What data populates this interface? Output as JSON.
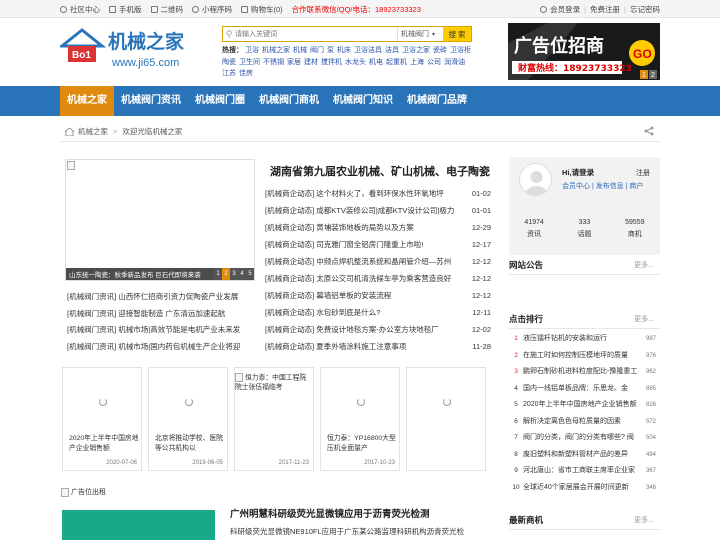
{
  "topbar": {
    "items": [
      {
        "icon": "home-icon",
        "label": "社区中心"
      },
      {
        "icon": "phone-icon",
        "label": "手机版"
      },
      {
        "icon": "qrcode-icon",
        "label": "二维码"
      },
      {
        "icon": "miniprogram-icon",
        "label": "小程序码"
      },
      {
        "icon": "cart-icon",
        "label": "购物车(0)"
      }
    ],
    "contact": "合作联系微信/QQ/电话：18923733323",
    "right": {
      "login": "会员登录",
      "register": "免费注册",
      "forgot": "忘记密码"
    }
  },
  "header": {
    "logo_text": "机械之家",
    "logo_badge": "Bo1",
    "logo_url": "www.ji65.com",
    "search_placeholder": "请输入关键词",
    "search_category": "机械阀门",
    "search_button": "搜 索",
    "hot_label": "热搜：",
    "hot_words": [
      "卫浴",
      "机械之家",
      "机械",
      "阀门",
      "泵",
      "机床",
      "卫浴洁具",
      "洁具",
      "卫浴之家",
      "瓷砖",
      "卫浴柜",
      "陶瓷",
      "卫生间",
      "不锈钢",
      "家居",
      "建材",
      "搅拌机",
      "水龙头",
      "机电",
      "起重机",
      "上海",
      "公司",
      "润滑油",
      "江苏",
      "佳房"
    ],
    "ad_title": "广告位招商",
    "ad_go": "GO",
    "ad_phone": "财富热线：18923733323",
    "ad_pager": [
      "1",
      "2"
    ]
  },
  "nav": [
    {
      "label": "机械之家",
      "active": true
    },
    {
      "label": "机械阀门资讯",
      "active": false
    },
    {
      "label": "机械阀门圈",
      "active": false
    },
    {
      "label": "机械阀门商机",
      "active": false
    },
    {
      "label": "机械阀门知识",
      "active": false
    },
    {
      "label": "机械阀门品牌",
      "active": false
    }
  ],
  "breadcrumb": {
    "home": "机械之家",
    "sep": ">",
    "current": "欢迎光临机械之家"
  },
  "slider": {
    "caption": "山东统一陶瓷：秋季新品发布 巨石代即将来袭",
    "dots": [
      "1",
      "2",
      "3",
      "4",
      "5"
    ]
  },
  "headline": "湖南省第九届农业机械、矿山机械、电子陶瓷",
  "news": [
    {
      "title": "[机械商企动态] 这个材料火了，看到环保水性环氧地坪",
      "date": "01-02"
    },
    {
      "title": "[机械商企动态] 成都KTV装修公司|成都KTV设计公司|极力",
      "date": "01-01"
    },
    {
      "title": "[机械商企动态] 黄埔装饰地板的局势以及方案",
      "date": "12-29"
    },
    {
      "title": "[机械商企动态] 司克雅门窗全铝房门隆重上市啦!",
      "date": "12-17"
    },
    {
      "title": "[机械商企动态] 中频点焊机整流系统和晶闸管介绍—苏州",
      "date": "12-12"
    },
    {
      "title": "[机械商企动态] 太原公交司机清洗候车亭为乘客营造良好",
      "date": "12-12"
    },
    {
      "title": "[机械商企动态] 幕墙铝单板的安装流程",
      "date": "12-12"
    },
    {
      "title": "[机械商企动态] 水包砂到底是什么?",
      "date": "12-11"
    },
    {
      "title": "[机械商企动态] 免费设计地毯方案-办公室方块地毯厂",
      "date": "12-02"
    },
    {
      "title": "[机械商企动态] 夏季外墙涂料施工注意事项",
      "date": "11-28"
    }
  ],
  "left_news": [
    "[机械阀门资讯] 山西怀仁招商引资力促陶瓷产业发展",
    "[机械阀门资讯] 迎接智能制造 广东清远加速起航",
    "[机械阀门资讯] 机械市场|高效节能是电机产业未来发",
    "[机械阀门资讯] 机械市场|国内药包机械生产企业将迎"
  ],
  "cards": [
    {
      "type": "spinner",
      "title": "2020年上半年中国房地产企业销售额",
      "date": "2020-07-06"
    },
    {
      "type": "spinner",
      "title": "北京将推动学校、医院等公共机构以",
      "date": "2019-06-05"
    },
    {
      "type": "broken",
      "alt": "恒力泰：中国工程院院士张伍福临考",
      "title": "",
      "date": "2017-11-23"
    },
    {
      "type": "spinner",
      "title": "恒力泰：YP16800大型压机全面量产",
      "date": "2017-10-23"
    },
    {
      "type": "spinner",
      "title": "",
      "date": ""
    }
  ],
  "ad_label": "广告位出租",
  "article": {
    "title": "广州明慧科研级荧光显微镜应用于沥青荧光检测",
    "summary": "科研级荧光显微镜NE910FL应用于广东某公路监理科研机构沥青荧光检"
  },
  "login": {
    "greeting": "Hi,请登录",
    "register": "注册",
    "links": "会员中心 | 发布信息 | 商户",
    "stats": [
      {
        "value": "41974",
        "label": "资讯"
      },
      {
        "value": "333",
        "label": "话题"
      },
      {
        "value": "59559",
        "label": "商机"
      }
    ]
  },
  "notice": {
    "title": "网站公告",
    "more": "更多..."
  },
  "ranking": {
    "title": "点击排行",
    "more": "更多...",
    "items": [
      {
        "n": "1",
        "title": "液压镭杆钻机的安装和运行",
        "count": "987"
      },
      {
        "n": "2",
        "title": "在施工时如何控制压模地坪的质量",
        "count": "976"
      },
      {
        "n": "3",
        "title": "鹏卵石制砂机进料粒度配比-豫隆重工",
        "count": "962"
      },
      {
        "n": "4",
        "title": "国内一线铝单板品牌：乐思龙、金",
        "count": "885"
      },
      {
        "n": "5",
        "title": "2020年上半年中国房地产企业销售额",
        "count": "826"
      },
      {
        "n": "6",
        "title": "解析决定离色色母粒质量的因素",
        "count": "572"
      },
      {
        "n": "7",
        "title": "阀门的分类，阀门的分类有哪些? 阀",
        "count": "504"
      },
      {
        "n": "8",
        "title": "废旧塑料和新塑料管材产品的差异",
        "count": "494"
      },
      {
        "n": "9",
        "title": "河北唐山：省市工商联主席率企业家",
        "count": "367"
      },
      {
        "n": "10",
        "title": "全球近40个家居展会开展时间更新",
        "count": "346"
      }
    ]
  },
  "latest": {
    "title": "最新商机",
    "more": "更多..."
  },
  "colors": {
    "nav": "#2a74ba",
    "nav_active": "#e08a10",
    "search_border": "#d9a300",
    "search_button": "#ffcc00",
    "red": "#e02020",
    "green": "#19a989"
  }
}
